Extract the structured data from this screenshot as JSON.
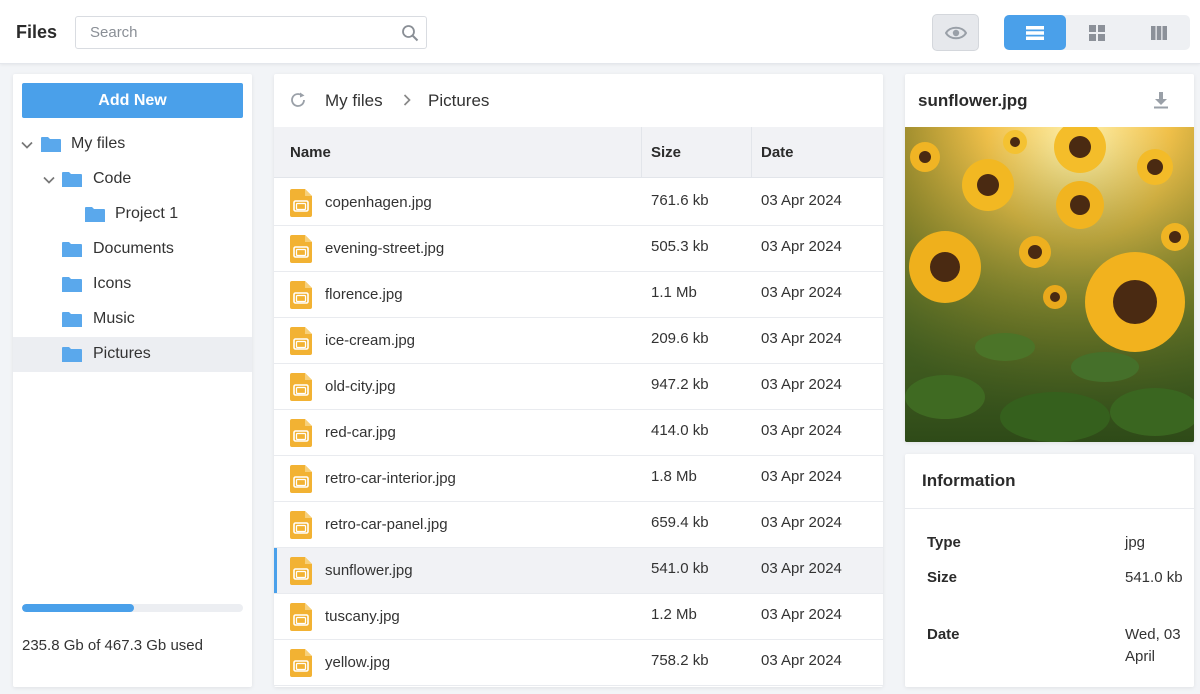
{
  "app": {
    "title": "Files"
  },
  "search": {
    "placeholder": "Search"
  },
  "toolbar": {
    "preview_toggle_icon": "eye-icon",
    "views": [
      {
        "name": "list",
        "icon": "list-view-icon",
        "active": true
      },
      {
        "name": "grid",
        "icon": "grid-view-icon",
        "active": false
      },
      {
        "name": "columns",
        "icon": "columns-view-icon",
        "active": false
      }
    ]
  },
  "sidebar": {
    "add_label": "Add New",
    "tree": [
      {
        "label": "My files",
        "depth": 0,
        "expanded": true
      },
      {
        "label": "Code",
        "depth": 1,
        "expanded": true
      },
      {
        "label": "Project 1",
        "depth": 2
      },
      {
        "label": "Documents",
        "depth": 1
      },
      {
        "label": "Icons",
        "depth": 1
      },
      {
        "label": "Music",
        "depth": 1
      },
      {
        "label": "Pictures",
        "depth": 1,
        "active": true
      }
    ],
    "storage": {
      "text": "235.8 Gb of 467.3 Gb used",
      "used_fraction": 0.505
    }
  },
  "breadcrumb": [
    "My files",
    "Pictures"
  ],
  "table": {
    "columns": [
      "Name",
      "Size",
      "Date"
    ],
    "rows": [
      {
        "name": "copenhagen.jpg",
        "size": "761.6 kb",
        "date": "03 Apr 2024"
      },
      {
        "name": "evening-street.jpg",
        "size": "505.3 kb",
        "date": "03 Apr 2024"
      },
      {
        "name": "florence.jpg",
        "size": "1.1 Mb",
        "date": "03 Apr 2024"
      },
      {
        "name": "ice-cream.jpg",
        "size": "209.6 kb",
        "date": "03 Apr 2024"
      },
      {
        "name": "old-city.jpg",
        "size": "947.2 kb",
        "date": "03 Apr 2024"
      },
      {
        "name": "red-car.jpg",
        "size": "414.0 kb",
        "date": "03 Apr 2024"
      },
      {
        "name": "retro-car-interior.jpg",
        "size": "1.8 Mb",
        "date": "03 Apr 2024"
      },
      {
        "name": "retro-car-panel.jpg",
        "size": "659.4 kb",
        "date": "03 Apr 2024"
      },
      {
        "name": "sunflower.jpg",
        "size": "541.0 kb",
        "date": "03 Apr 2024",
        "selected": true
      },
      {
        "name": "tuscany.jpg",
        "size": "1.2 Mb",
        "date": "03 Apr 2024"
      },
      {
        "name": "yellow.jpg",
        "size": "758.2 kb",
        "date": "03 Apr 2024"
      }
    ]
  },
  "preview": {
    "title": "sunflower.jpg"
  },
  "info": {
    "title": "Information",
    "type_label": "Type",
    "type_value": "jpg",
    "size_label": "Size",
    "size_value": "541.0 kb",
    "date_label": "Date",
    "date_value": "Wed, 03 April"
  },
  "colors": {
    "accent": "#4aa0ea",
    "file_icon": "#f2b233",
    "folder": "#5aa8ec"
  }
}
